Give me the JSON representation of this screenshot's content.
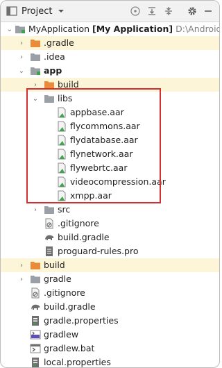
{
  "toolbar": {
    "title": "Project",
    "icons": [
      "project-view-icon",
      "dropdown-arrow-icon",
      "crosshair-icon",
      "expand-all-icon",
      "collapse-all-icon",
      "gear-icon",
      "minimize-icon"
    ]
  },
  "tree": {
    "root": {
      "name": "MyApplication",
      "bracket": "[My Application]",
      "path": "D:\\AndroidProje"
    },
    "gradle_dir": ".gradle",
    "idea_dir": ".idea",
    "app": "app",
    "app_build": "build",
    "libs": "libs",
    "aar_files": [
      "appbase.aar",
      "flycommons.aar",
      "flydatabase.aar",
      "flynetwork.aar",
      "flywebrtc.aar",
      "videocompression.aar",
      "xmpp.aar"
    ],
    "src": "src",
    "app_gitignore": ".gitignore",
    "app_build_gradle": "build.gradle",
    "proguard": "proguard-rules.pro",
    "build": "build",
    "gradle": "gradle",
    "gitignore": ".gitignore",
    "build_gradle": "build.gradle",
    "gradle_properties": "gradle.properties",
    "gradlew": "gradlew",
    "gradlew_bat": "gradlew.bat",
    "local_properties": "local.properties"
  },
  "colors": {
    "highlight_row": "#fdf5d8",
    "selection_box": "#d32f2f",
    "folder_orange": "#e88b3a",
    "folder_gray": "#9aa0a6",
    "module_green": "#3fa34d"
  }
}
